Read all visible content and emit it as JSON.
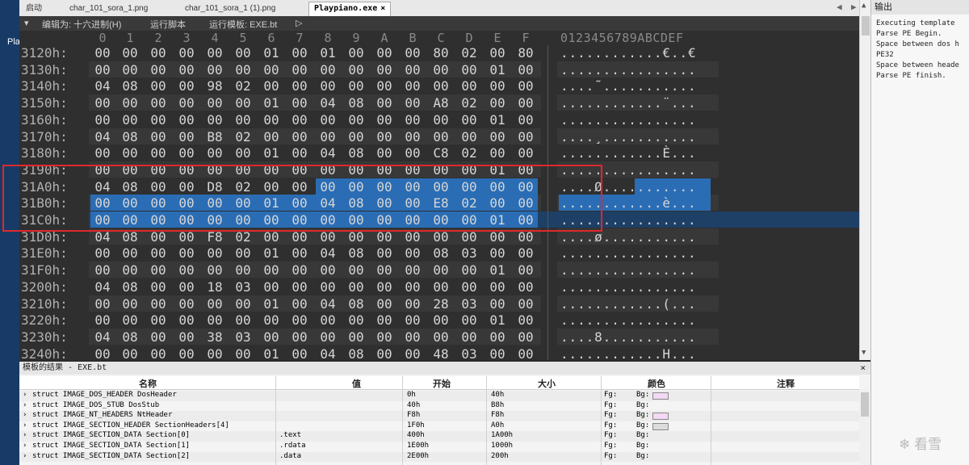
{
  "desktop": {
    "label": "Pla"
  },
  "tabs": [
    {
      "label": "启动"
    },
    {
      "label": "char_101_sora_1.png"
    },
    {
      "label": "char_101_sora_1 (1).png"
    },
    {
      "label": "Playpiano.exe"
    }
  ],
  "tab_close": "×",
  "toolbar": {
    "edit_as": "编辑为: 十六进制(H)",
    "run_script": "运行脚本",
    "run_template": "运行模板: EXE.bt"
  },
  "hex": {
    "col_headers": [
      "0",
      "1",
      "2",
      "3",
      "4",
      "5",
      "6",
      "7",
      "8",
      "9",
      "A",
      "B",
      "C",
      "D",
      "E",
      "F"
    ],
    "ascii_header": "0123456789ABCDEF",
    "rows": [
      {
        "addr": "3120h:",
        "bytes": [
          "00",
          "00",
          "00",
          "00",
          "00",
          "00",
          "01",
          "00",
          "01",
          "00",
          "00",
          "00",
          "80",
          "02",
          "00",
          "80"
        ],
        "ascii": "............€..€"
      },
      {
        "addr": "3130h:",
        "bytes": [
          "00",
          "00",
          "00",
          "00",
          "00",
          "00",
          "00",
          "00",
          "00",
          "00",
          "00",
          "00",
          "00",
          "00",
          "01",
          "00"
        ],
        "ascii": "................"
      },
      {
        "addr": "3140h:",
        "bytes": [
          "04",
          "08",
          "00",
          "00",
          "98",
          "02",
          "00",
          "00",
          "00",
          "00",
          "00",
          "00",
          "00",
          "00",
          "00",
          "00"
        ],
        "ascii": "....˜..........."
      },
      {
        "addr": "3150h:",
        "bytes": [
          "00",
          "00",
          "00",
          "00",
          "00",
          "00",
          "01",
          "00",
          "04",
          "08",
          "00",
          "00",
          "A8",
          "02",
          "00",
          "00"
        ],
        "ascii": "............¨..."
      },
      {
        "addr": "3160h:",
        "bytes": [
          "00",
          "00",
          "00",
          "00",
          "00",
          "00",
          "00",
          "00",
          "00",
          "00",
          "00",
          "00",
          "00",
          "00",
          "01",
          "00"
        ],
        "ascii": "................"
      },
      {
        "addr": "3170h:",
        "bytes": [
          "04",
          "08",
          "00",
          "00",
          "B8",
          "02",
          "00",
          "00",
          "00",
          "00",
          "00",
          "00",
          "00",
          "00",
          "00",
          "00"
        ],
        "ascii": "....¸..........."
      },
      {
        "addr": "3180h:",
        "bytes": [
          "00",
          "00",
          "00",
          "00",
          "00",
          "00",
          "01",
          "00",
          "04",
          "08",
          "00",
          "00",
          "C8",
          "02",
          "00",
          "00"
        ],
        "ascii": "............È..."
      },
      {
        "addr": "3190h:",
        "bytes": [
          "00",
          "00",
          "00",
          "00",
          "00",
          "00",
          "00",
          "00",
          "00",
          "00",
          "00",
          "00",
          "00",
          "00",
          "01",
          "00"
        ],
        "ascii": "................"
      },
      {
        "addr": "31A0h:",
        "bytes": [
          "04",
          "08",
          "00",
          "00",
          "D8",
          "02",
          "00",
          "00",
          "00",
          "00",
          "00",
          "00",
          "00",
          "00",
          "00",
          "00"
        ],
        "ascii": "....Ø..........."
      },
      {
        "addr": "31B0h:",
        "bytes": [
          "00",
          "00",
          "00",
          "00",
          "00",
          "00",
          "01",
          "00",
          "04",
          "08",
          "00",
          "00",
          "E8",
          "02",
          "00",
          "00"
        ],
        "ascii": "............è..."
      },
      {
        "addr": "31C0h:",
        "bytes": [
          "00",
          "00",
          "00",
          "00",
          "00",
          "00",
          "00",
          "00",
          "00",
          "00",
          "00",
          "00",
          "00",
          "00",
          "01",
          "00"
        ],
        "ascii": "................"
      },
      {
        "addr": "31D0h:",
        "bytes": [
          "04",
          "08",
          "00",
          "00",
          "F8",
          "02",
          "00",
          "00",
          "00",
          "00",
          "00",
          "00",
          "00",
          "00",
          "00",
          "00"
        ],
        "ascii": "....ø..........."
      },
      {
        "addr": "31E0h:",
        "bytes": [
          "00",
          "00",
          "00",
          "00",
          "00",
          "00",
          "01",
          "00",
          "04",
          "08",
          "00",
          "00",
          "08",
          "03",
          "00",
          "00"
        ],
        "ascii": "................"
      },
      {
        "addr": "31F0h:",
        "bytes": [
          "00",
          "00",
          "00",
          "00",
          "00",
          "00",
          "00",
          "00",
          "00",
          "00",
          "00",
          "00",
          "00",
          "00",
          "01",
          "00"
        ],
        "ascii": "................"
      },
      {
        "addr": "3200h:",
        "bytes": [
          "04",
          "08",
          "00",
          "00",
          "18",
          "03",
          "00",
          "00",
          "00",
          "00",
          "00",
          "00",
          "00",
          "00",
          "00",
          "00"
        ],
        "ascii": "................"
      },
      {
        "addr": "3210h:",
        "bytes": [
          "00",
          "00",
          "00",
          "00",
          "00",
          "00",
          "01",
          "00",
          "04",
          "08",
          "00",
          "00",
          "28",
          "03",
          "00",
          "00"
        ],
        "ascii": "............(..."
      },
      {
        "addr": "3220h:",
        "bytes": [
          "00",
          "00",
          "00",
          "00",
          "00",
          "00",
          "00",
          "00",
          "00",
          "00",
          "00",
          "00",
          "00",
          "00",
          "01",
          "00"
        ],
        "ascii": "................"
      },
      {
        "addr": "3230h:",
        "bytes": [
          "04",
          "08",
          "00",
          "00",
          "38",
          "03",
          "00",
          "00",
          "00",
          "00",
          "00",
          "00",
          "00",
          "00",
          "00",
          "00"
        ],
        "ascii": "....8..........."
      },
      {
        "addr": "3240h:",
        "bytes": [
          "00",
          "00",
          "00",
          "00",
          "00",
          "00",
          "01",
          "00",
          "04",
          "08",
          "00",
          "00",
          "48",
          "03",
          "00",
          "00"
        ],
        "ascii": "............H..."
      }
    ]
  },
  "results": {
    "title": "模板的结果 - EXE.bt",
    "close": "×",
    "headers": {
      "name": "名称",
      "value": "值",
      "start": "开始",
      "size": "大小",
      "color": "颜色",
      "comment": "注释"
    },
    "rows": [
      {
        "name": "struct IMAGE_DOS_HEADER DosHeader",
        "value": "",
        "start": "0h",
        "size": "40h",
        "fg": "Fg:",
        "bg": "Bg:",
        "swatch": "#f4d8f4"
      },
      {
        "name": "struct IMAGE_DOS_STUB DosStub",
        "value": "",
        "start": "40h",
        "size": "B8h",
        "fg": "Fg:",
        "bg": "Bg:",
        "swatch": ""
      },
      {
        "name": "struct IMAGE_NT_HEADERS NtHeader",
        "value": "",
        "start": "F8h",
        "size": "F8h",
        "fg": "Fg:",
        "bg": "Bg:",
        "swatch": "#f4d8f4"
      },
      {
        "name": "struct IMAGE_SECTION_HEADER SectionHeaders[4]",
        "value": "",
        "start": "1F0h",
        "size": "A0h",
        "fg": "Fg:",
        "bg": "Bg:",
        "swatch": "#dcdcdc"
      },
      {
        "name": "struct IMAGE_SECTION_DATA Section[0]",
        "value": ".text",
        "start": "400h",
        "size": "1A00h",
        "fg": "Fg:",
        "bg": "Bg:",
        "swatch": ""
      },
      {
        "name": "struct IMAGE_SECTION_DATA Section[1]",
        "value": ".rdata",
        "start": "1E00h",
        "size": "1000h",
        "fg": "Fg:",
        "bg": "Bg:",
        "swatch": ""
      },
      {
        "name": "struct IMAGE_SECTION_DATA Section[2]",
        "value": ".data",
        "start": "2E00h",
        "size": "200h",
        "fg": "Fg:",
        "bg": "Bg:",
        "swatch": ""
      }
    ]
  },
  "output": {
    "title": "输出",
    "lines": [
      "Executing template",
      "Parse PE Begin.",
      "Space between dos h",
      "PE32",
      "Space between heade",
      "Parse PE finish."
    ]
  },
  "watermark": "看雪",
  "colors": {
    "selection": "#2a6db5",
    "selected_row": "#1e3f66",
    "annotation_box": "#e0282d"
  }
}
